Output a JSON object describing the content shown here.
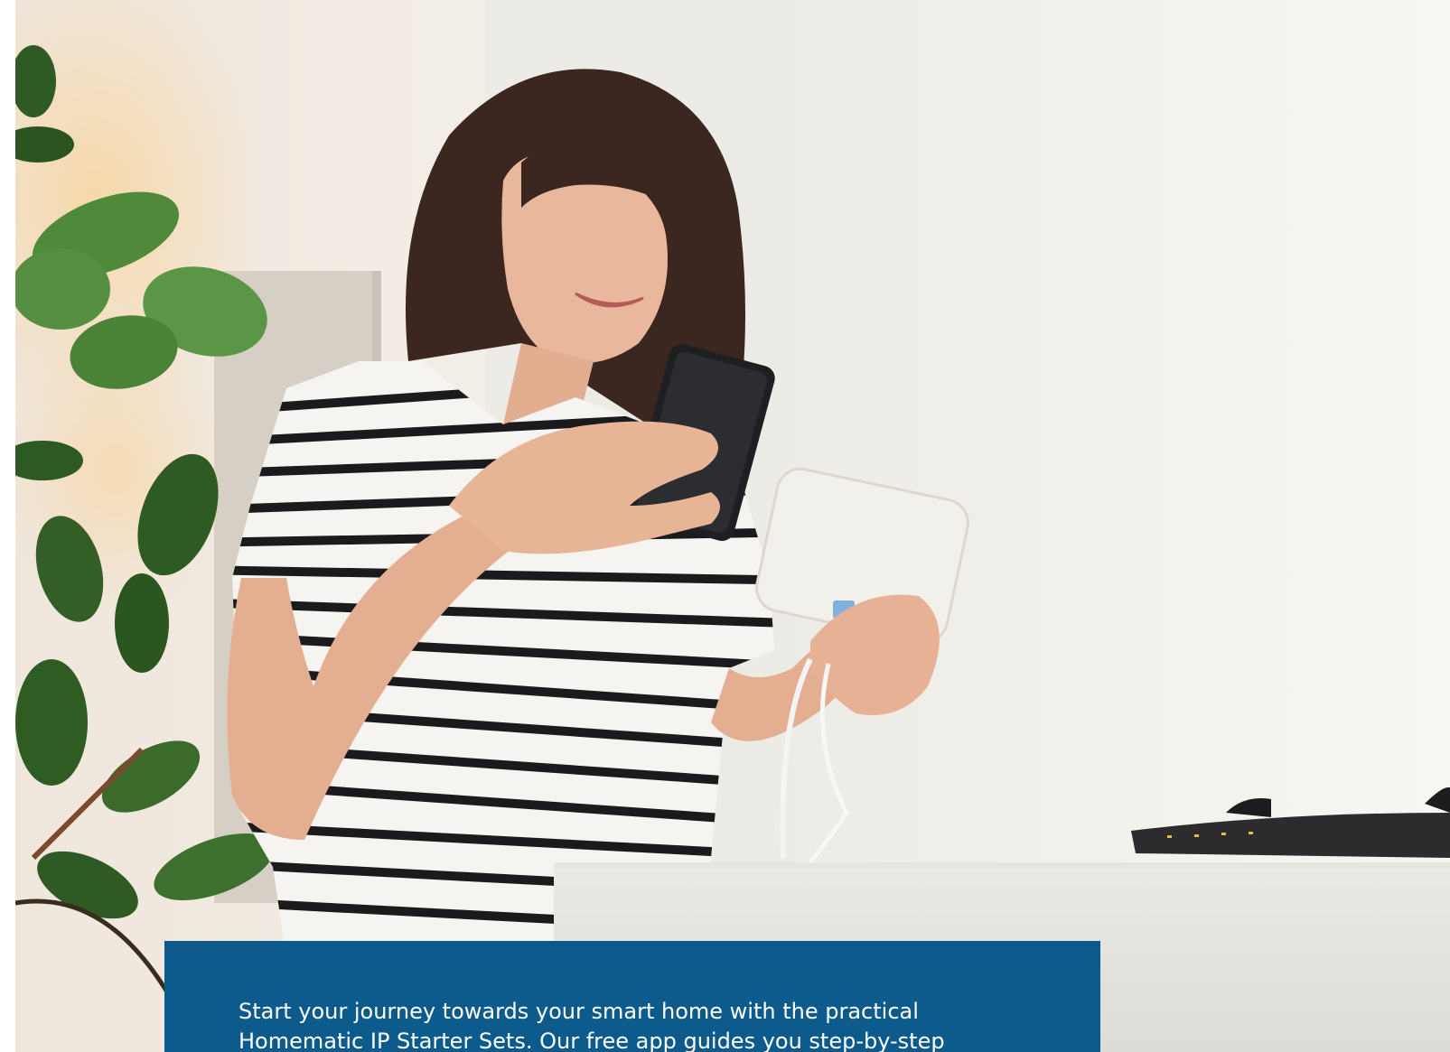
{
  "caption": {
    "line1": "Start your journey towards your smart home with the practical",
    "line2": "Homematic IP Starter Sets. Our free app guides you step-by-step"
  },
  "colors": {
    "panel": "#0d5a8c",
    "text": "#ffffff",
    "stripe": "#1b1b1d",
    "wall": "#f4f2ed"
  },
  "icons": {
    "photo": "woman-with-smartphone-and-access-point-photo"
  }
}
